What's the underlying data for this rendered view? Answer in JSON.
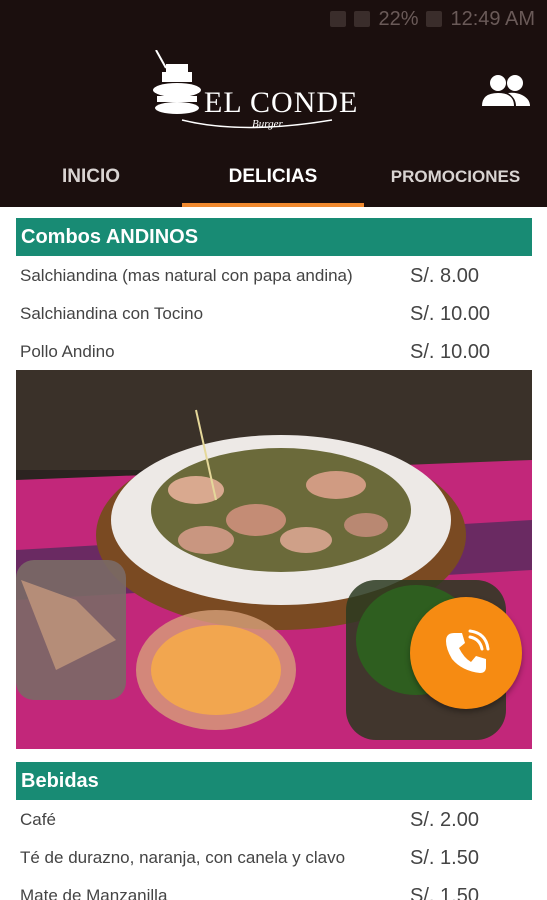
{
  "status_bar": {
    "battery": "22%",
    "time": "12:49 AM"
  },
  "brand": {
    "name": "EL CONDE",
    "subtitle": "Burger"
  },
  "tabs": [
    {
      "label": "INICIO",
      "active": false
    },
    {
      "label": "DELICIAS",
      "active": true
    },
    {
      "label": "PROMOCIONES",
      "active": false
    }
  ],
  "sections": [
    {
      "title": "Combos ANDINOS",
      "items": [
        {
          "name": "Salchiandina (mas natural con papa andina)",
          "price": "S/.  8.00"
        },
        {
          "name": "Salchiandina con Tocino",
          "price": "S/. 10.00"
        },
        {
          "name": "Pollo Andino",
          "price": "S/. 10.00"
        }
      ]
    },
    {
      "title": "Bebidas",
      "items": [
        {
          "name": "Café",
          "price": "S/.  2.00"
        },
        {
          "name": "Té de durazno, naranja, con canela y clavo",
          "price": "S/.  1.50"
        },
        {
          "name": "Mate de Manzanilla",
          "price": "S/.  1.50"
        }
      ]
    }
  ],
  "colors": {
    "app_bar": "#1b0f0e",
    "section_header": "#188b74",
    "tab_indicator": "#f0892f",
    "fab": "#f68b12"
  },
  "icons": {
    "account": "people-icon",
    "call": "phone-icon"
  }
}
